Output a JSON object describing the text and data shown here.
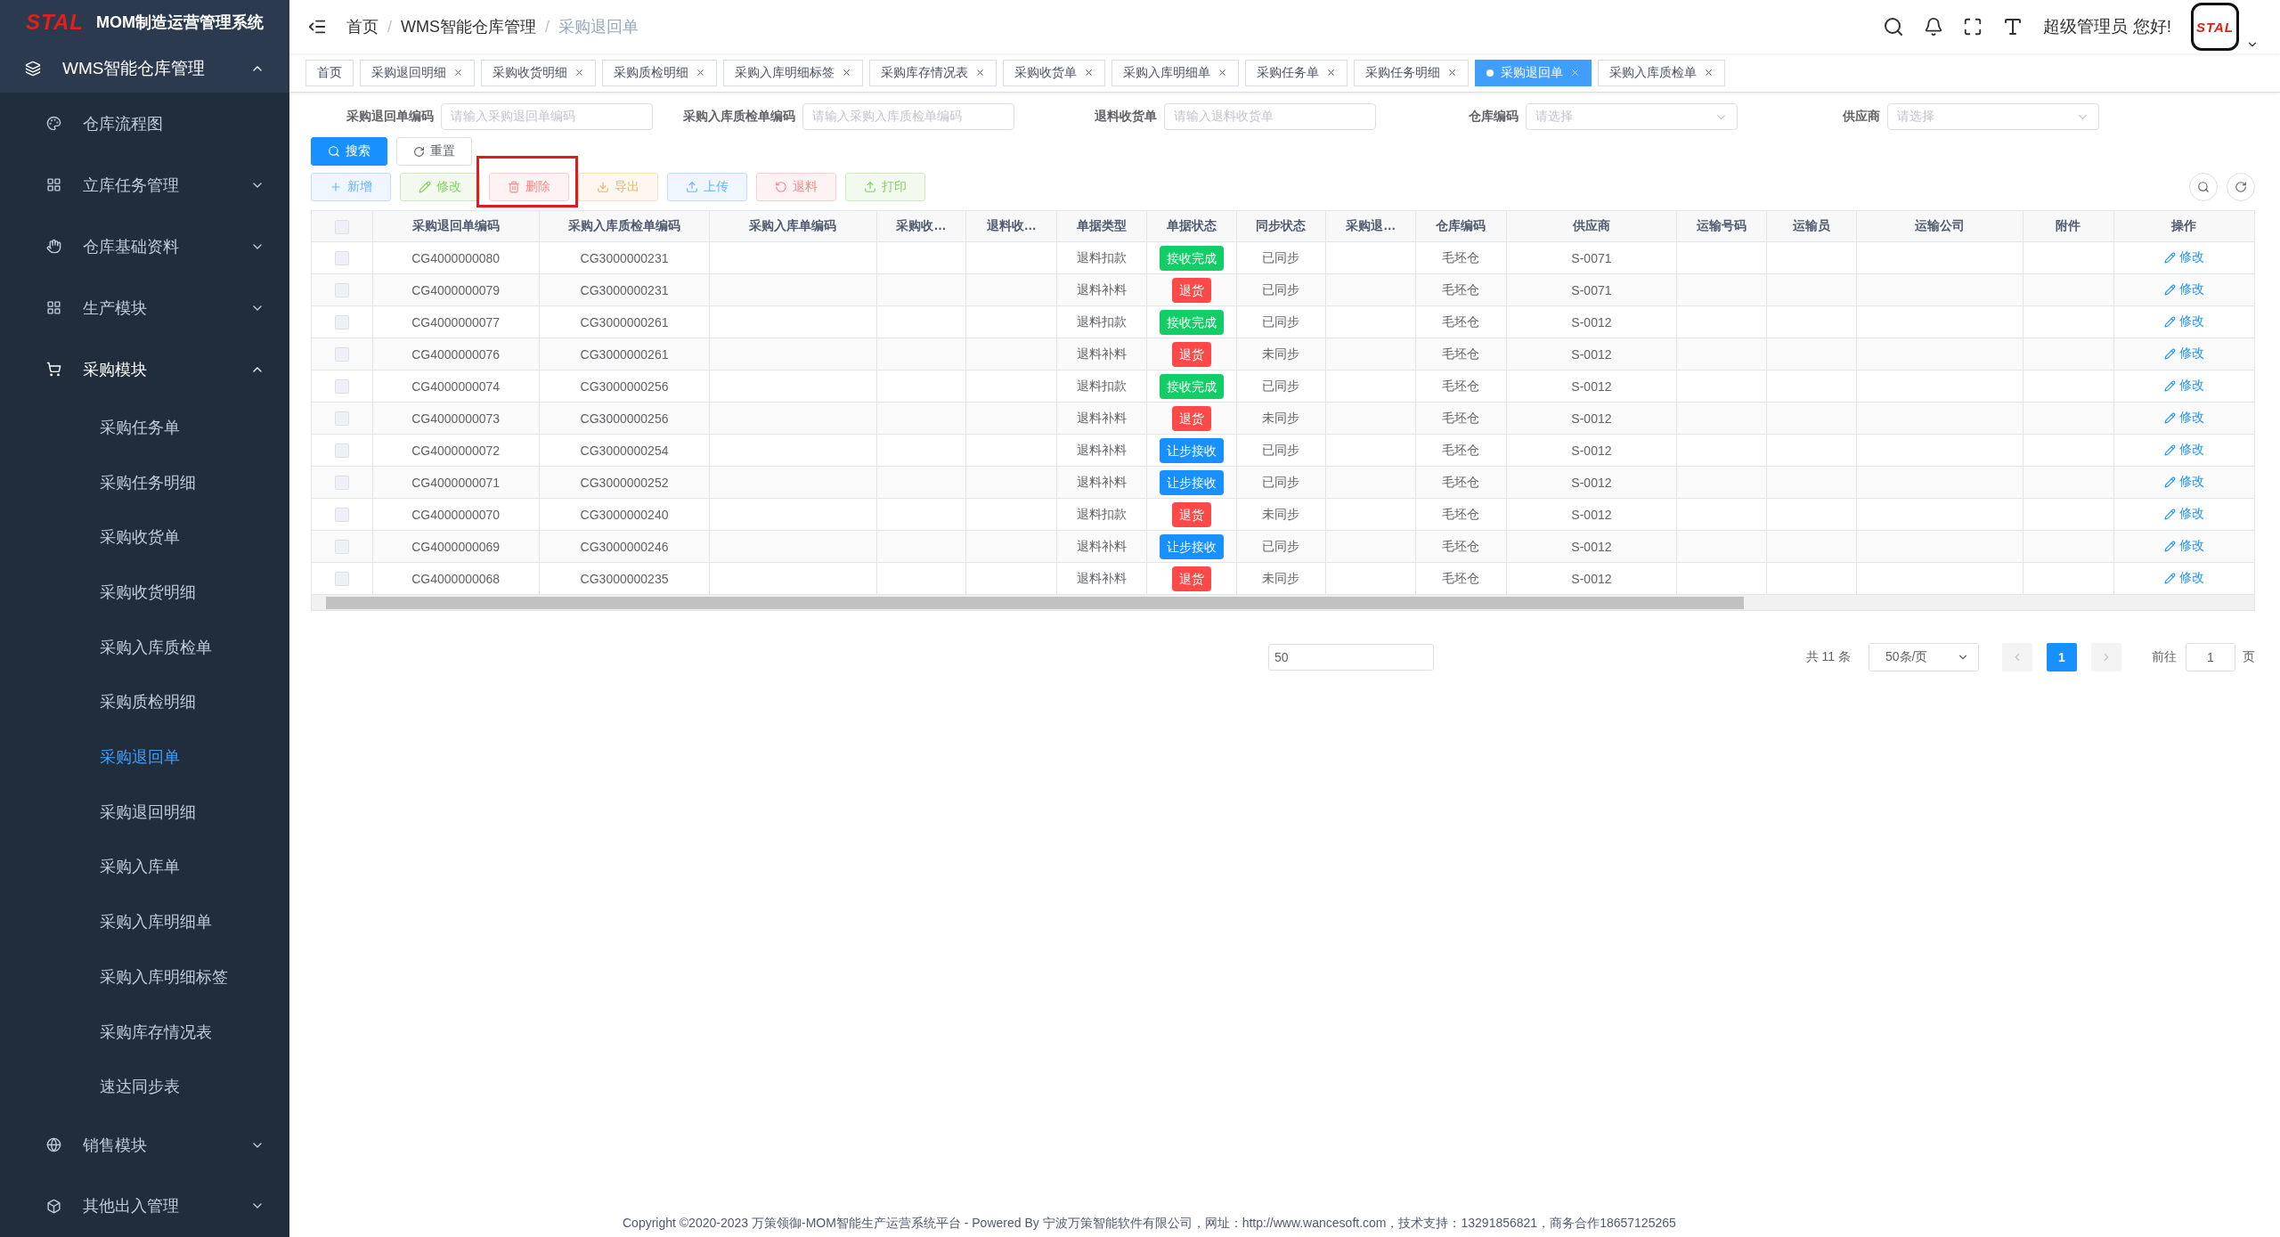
{
  "brand": {
    "logo": "STAL",
    "title": "MOM制造运营管理系统"
  },
  "sidebar": {
    "items": [
      {
        "label": "WMS智能仓库管理",
        "expanded": true,
        "children": [
          {
            "label": "仓库流程图"
          },
          {
            "label": "立库任务管理",
            "expanded": false
          },
          {
            "label": "仓库基础资料",
            "expanded": false
          },
          {
            "label": "生产模块",
            "expanded": false
          },
          {
            "label": "采购模块",
            "expanded": true,
            "children": [
              {
                "label": "采购任务单",
                "selected": false
              },
              {
                "label": "采购任务明细",
                "selected": false
              },
              {
                "label": "采购收货单",
                "selected": false
              },
              {
                "label": "采购收货明细",
                "selected": false
              },
              {
                "label": "采购入库质检单",
                "selected": false
              },
              {
                "label": "采购质检明细",
                "selected": false
              },
              {
                "label": "采购退回单",
                "selected": true
              },
              {
                "label": "采购退回明细",
                "selected": false
              },
              {
                "label": "采购入库单",
                "selected": false
              },
              {
                "label": "采购入库明细单",
                "selected": false
              },
              {
                "label": "采购入库明细标签",
                "selected": false
              },
              {
                "label": "采购库存情况表",
                "selected": false
              },
              {
                "label": "速达同步表",
                "selected": false
              }
            ]
          },
          {
            "label": "销售模块",
            "expanded": false
          },
          {
            "label": "其他出入管理",
            "expanded": false
          }
        ]
      }
    ]
  },
  "breadcrumb": [
    "首页",
    "WMS智能仓库管理",
    "采购退回单"
  ],
  "breadcrumb_separator": "/",
  "user": {
    "greeting": "超级管理员 您好!",
    "avatar_logo": "STAL"
  },
  "tabs": [
    {
      "label": "首页",
      "selected": false,
      "closable": false
    },
    {
      "label": "采购退回明细",
      "selected": false,
      "closable": true
    },
    {
      "label": "采购收货明细",
      "selected": false,
      "closable": true
    },
    {
      "label": "采购质检明细",
      "selected": false,
      "closable": true
    },
    {
      "label": "采购入库明细标签",
      "selected": false,
      "closable": true
    },
    {
      "label": "采购库存情况表",
      "selected": false,
      "closable": true
    },
    {
      "label": "采购收货单",
      "selected": false,
      "closable": true
    },
    {
      "label": "采购入库明细单",
      "selected": false,
      "closable": true
    },
    {
      "label": "采购任务单",
      "selected": false,
      "closable": true
    },
    {
      "label": "采购任务明细",
      "selected": false,
      "closable": true
    },
    {
      "label": "采购退回单",
      "selected": true,
      "closable": true
    },
    {
      "label": "采购入库质检单",
      "selected": false,
      "closable": true
    }
  ],
  "filters": [
    {
      "label": "采购退回单编码",
      "placeholder": "请输入采购退回单编码",
      "kind": "input"
    },
    {
      "label": "采购入库质检单编码",
      "placeholder": "请输入采购入库质检单编码",
      "kind": "input"
    },
    {
      "label": "退料收货单",
      "placeholder": "请输入退料收货单",
      "kind": "input"
    },
    {
      "label": "仓库编码",
      "placeholder": "请选择",
      "kind": "select"
    },
    {
      "label": "供应商",
      "placeholder": "请选择",
      "kind": "select"
    }
  ],
  "search_buttons": [
    {
      "label": "搜索",
      "kind": "primary"
    },
    {
      "label": "重置",
      "kind": "default"
    }
  ],
  "toolbar": [
    {
      "label": "新增",
      "kind": "primary",
      "highlighted": false
    },
    {
      "label": "修改",
      "kind": "success",
      "highlighted": false
    },
    {
      "label": "删除",
      "kind": "danger",
      "highlighted": true
    },
    {
      "label": "导出",
      "kind": "warning",
      "highlighted": false
    },
    {
      "label": "上传",
      "kind": "primary",
      "highlighted": false
    },
    {
      "label": "退料",
      "kind": "danger",
      "highlighted": false
    },
    {
      "label": "打印",
      "kind": "success",
      "highlighted": false
    }
  ],
  "table": {
    "all_selected": false,
    "columns": [
      "采购退回单编码",
      "采购入库质检单编码",
      "采购入库单编码",
      "采购收…",
      "退料收…",
      "单据类型",
      "单据状态",
      "同步状态",
      "采购退…",
      "仓库编码",
      "供应商",
      "运输号码",
      "运输员",
      "运输公司",
      "附件",
      "操作"
    ],
    "rows": [
      {
        "selected": false,
        "return_no": "CG4000000080",
        "qc_no": "CG3000000231",
        "type": "退料扣款",
        "status": {
          "text": "接收完成",
          "color": "#13ce66"
        },
        "sync": "已同步",
        "warehouse": "毛坯仓",
        "supplier": "S-0071",
        "action": "修改"
      },
      {
        "selected": false,
        "return_no": "CG4000000079",
        "qc_no": "CG3000000231",
        "type": "退料补料",
        "status": {
          "text": "退货",
          "color": "#ff4949"
        },
        "sync": "已同步",
        "warehouse": "毛坯仓",
        "supplier": "S-0071",
        "action": "修改"
      },
      {
        "selected": false,
        "return_no": "CG4000000077",
        "qc_no": "CG3000000261",
        "type": "退料扣款",
        "status": {
          "text": "接收完成",
          "color": "#13ce66"
        },
        "sync": "已同步",
        "warehouse": "毛坯仓",
        "supplier": "S-0012",
        "action": "修改"
      },
      {
        "selected": false,
        "return_no": "CG4000000076",
        "qc_no": "CG3000000261",
        "type": "退料补料",
        "status": {
          "text": "退货",
          "color": "#ff4949"
        },
        "sync": "未同步",
        "warehouse": "毛坯仓",
        "supplier": "S-0012",
        "action": "修改"
      },
      {
        "selected": false,
        "return_no": "CG4000000074",
        "qc_no": "CG3000000256",
        "type": "退料扣款",
        "status": {
          "text": "接收完成",
          "color": "#13ce66"
        },
        "sync": "已同步",
        "warehouse": "毛坯仓",
        "supplier": "S-0012",
        "action": "修改"
      },
      {
        "selected": false,
        "return_no": "CG4000000073",
        "qc_no": "CG3000000256",
        "type": "退料补料",
        "status": {
          "text": "退货",
          "color": "#ff4949"
        },
        "sync": "未同步",
        "warehouse": "毛坯仓",
        "supplier": "S-0012",
        "action": "修改"
      },
      {
        "selected": false,
        "return_no": "CG4000000072",
        "qc_no": "CG3000000254",
        "type": "退料补料",
        "status": {
          "text": "让步接收",
          "color": "#1890ff"
        },
        "sync": "已同步",
        "warehouse": "毛坯仓",
        "supplier": "S-0012",
        "action": "修改"
      },
      {
        "selected": false,
        "return_no": "CG4000000071",
        "qc_no": "CG3000000252",
        "type": "退料补料",
        "status": {
          "text": "让步接收",
          "color": "#1890ff"
        },
        "sync": "已同步",
        "warehouse": "毛坯仓",
        "supplier": "S-0012",
        "action": "修改"
      },
      {
        "selected": false,
        "return_no": "CG4000000070",
        "qc_no": "CG3000000240",
        "type": "退料扣款",
        "status": {
          "text": "退货",
          "color": "#ff4949"
        },
        "sync": "未同步",
        "warehouse": "毛坯仓",
        "supplier": "S-0012",
        "action": "修改"
      },
      {
        "selected": false,
        "return_no": "CG4000000069",
        "qc_no": "CG3000000246",
        "type": "退料补料",
        "status": {
          "text": "让步接收",
          "color": "#1890ff"
        },
        "sync": "已同步",
        "warehouse": "毛坯仓",
        "supplier": "S-0012",
        "action": "修改"
      },
      {
        "selected": false,
        "return_no": "CG4000000068",
        "qc_no": "CG3000000235",
        "type": "退料补料",
        "status": {
          "text": "退货",
          "color": "#ff4949"
        },
        "sync": "未同步",
        "warehouse": "毛坯仓",
        "supplier": "S-0012",
        "action": "修改"
      }
    ]
  },
  "pagination": {
    "stray_input": "50",
    "total": "共 11 条",
    "page_size": "50条/页",
    "pages": [
      {
        "label": "1",
        "selected": true
      }
    ],
    "goto_label": "前往",
    "goto_value": "1",
    "goto_suffix": "页"
  },
  "footer": "Copyright ©2020-2023 万策领御-MOM智能生产运营系统平台 - Powered By 宁波万策智能软件有限公司，网址：http://www.wancesoft.com，技术支持：13291856821，商务合作18657125265"
}
